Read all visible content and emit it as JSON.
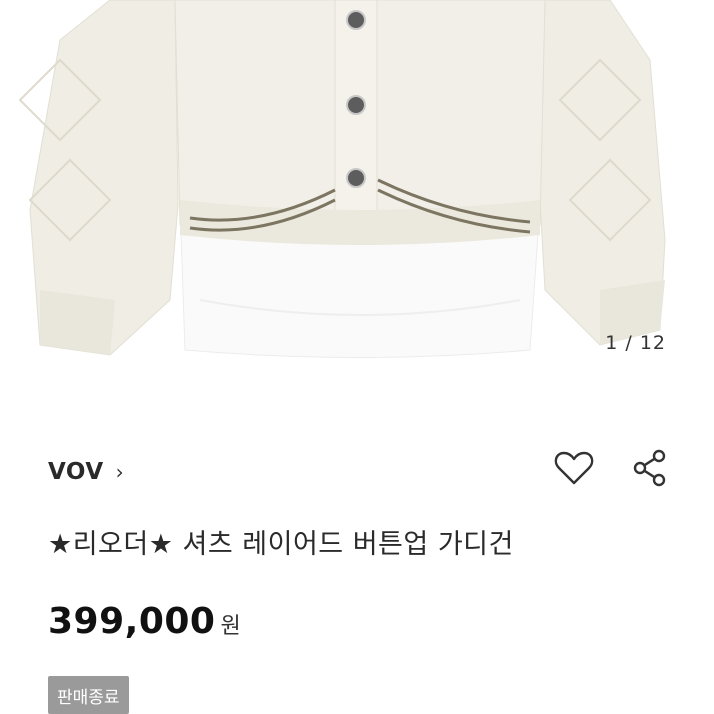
{
  "gallery": {
    "current": "1",
    "separator": " / ",
    "total": "12"
  },
  "brand": {
    "name": "VOV",
    "chevron": "›"
  },
  "actions": {
    "like_icon": "heart-outline-icon",
    "share_icon": "share-icon"
  },
  "product": {
    "title": "★리오더★ 셔츠 레이어드 버튼업 가디건",
    "price": "399,000",
    "currency": "원",
    "status": "판매종료"
  },
  "colors": {
    "status_badge": "#9a9a9a",
    "text_primary": "#111111",
    "knit": "#efede4",
    "shirt": "#fbfbfb"
  }
}
